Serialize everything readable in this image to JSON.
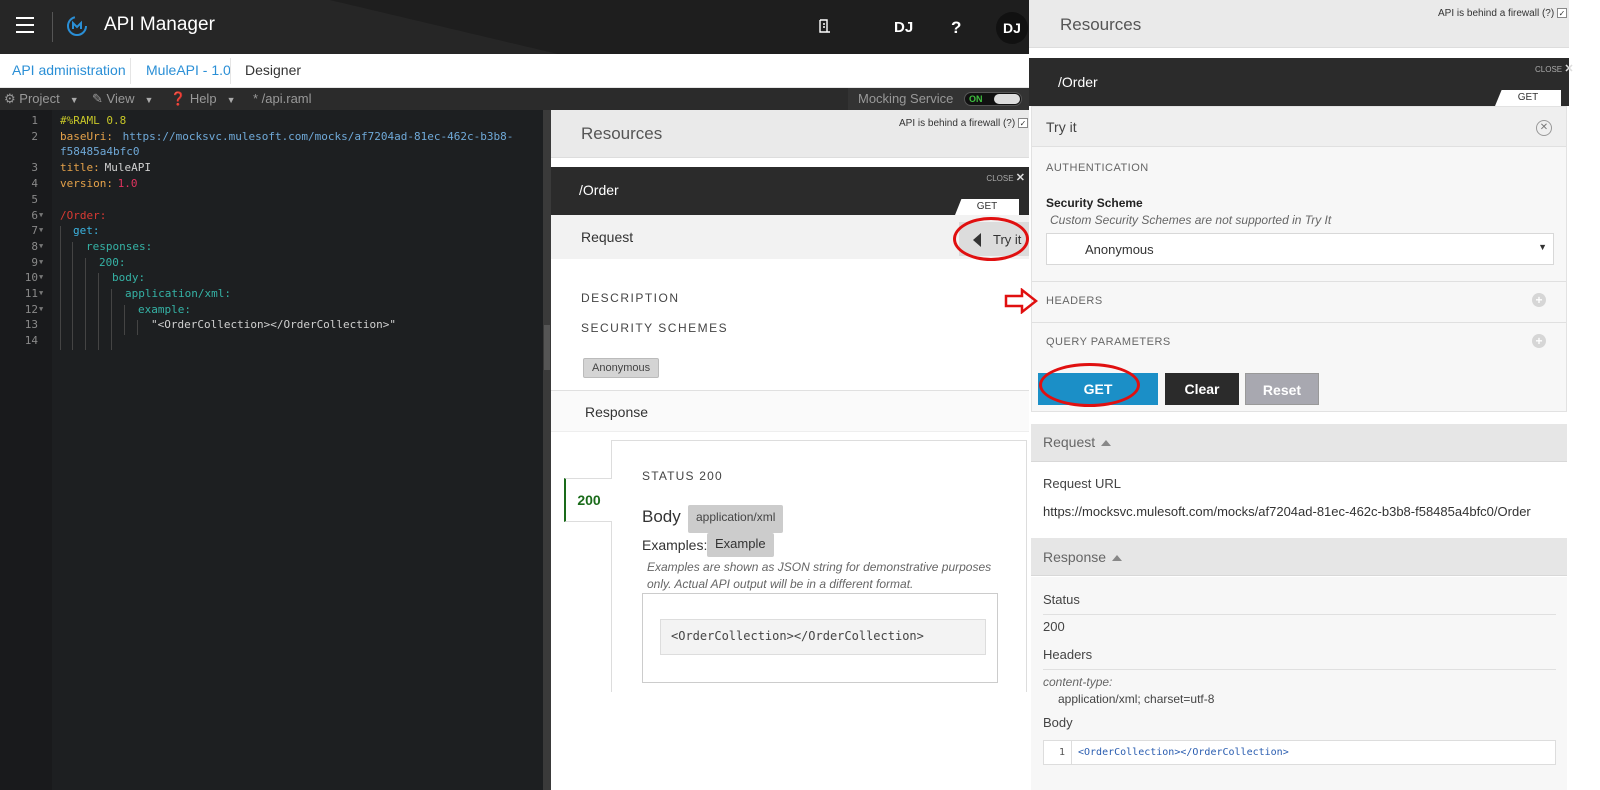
{
  "app": {
    "title": "API Manager",
    "user_initials": "DJ",
    "avatar_initials": "DJ",
    "help_symbol": "?"
  },
  "breadcrumb": [
    "API administration",
    "MuleAPI - 1.0",
    "Designer"
  ],
  "toolbar": {
    "project": "Project",
    "view": "View",
    "help": "Help",
    "file": "* /api.raml",
    "mocking_label": "Mocking Service",
    "mocking_state": "ON"
  },
  "editor": {
    "line_numbers": [
      "1",
      "2",
      "",
      "3",
      "4",
      "5",
      "6",
      "7",
      "8",
      "9",
      "10",
      "11",
      "12",
      "13",
      "14"
    ],
    "lines": {
      "l1": "#%RAML 0.8",
      "l2a_key": "baseUri:",
      "l2a_val": " https://mocksvc.mulesoft.com/mocks/af7204ad-81ec-462c-b3b8-",
      "l2b_val": "f58485a4bfc0",
      "l3_key": "title:",
      "l3_val": " MuleAPI",
      "l4_key": "version:",
      "l4_val": " 1.0",
      "l6": "/Order:",
      "l7": "get:",
      "l8": "responses:",
      "l9": "200:",
      "l10": "body:",
      "l11": "application/xml:",
      "l12": "example:",
      "l13": "\"<OrderCollection></OrderCollection>\""
    }
  },
  "docs": {
    "resources_title": "Resources",
    "firewall_label": "API is behind a firewall",
    "firewall_q": "(?)",
    "resource": "/Order",
    "close": "CLOSE",
    "method": "GET",
    "request_label": "Request",
    "tryit_label": "Try it",
    "description": "DESCRIPTION",
    "security_schemes": "SECURITY SCHEMES",
    "anonymous_badge": "Anonymous",
    "response_label": "Response",
    "status_code": "200",
    "status_title": "STATUS 200",
    "body_label": "Body",
    "body_type": "application/xml",
    "examples_label": "Examples:",
    "example_badge": "Example",
    "examples_note": "Examples are shown as JSON string for demonstrative purposes only. Actual API output will be in a different format.",
    "example_code": "<OrderCollection></OrderCollection>"
  },
  "tryit": {
    "title": "Try it",
    "authentication": "AUTHENTICATION",
    "security_scheme_label": "Security Scheme",
    "security_scheme_note": "Custom Security Schemes are not supported in Try It",
    "scheme_value": "Anonymous",
    "headers": "HEADERS",
    "query_parameters": "QUERY PARAMETERS",
    "get_button": "GET",
    "clear_button": "Clear",
    "reset_button": "Reset"
  },
  "result": {
    "request_label": "Request",
    "request_url_label": "Request URL",
    "request_url": "https://mocksvc.mulesoft.com/mocks/af7204ad-81ec-462c-b3b8-f58485a4bfc0/Order",
    "response_label": "Response",
    "status_label": "Status",
    "status_value": "200",
    "headers_label": "Headers",
    "content_type_key": "content-type:",
    "content_type_value": "application/xml; charset=utf-8",
    "body_label": "Body",
    "body_line_number": "1",
    "body_code": "<OrderCollection></OrderCollection>"
  },
  "colors": {
    "accent_blue": "#1b8fc7",
    "link_blue": "#2a8fd6",
    "status_green": "#1a6b1a",
    "annotation_red": "#e01010"
  },
  "icons": [
    "hamburger-icon",
    "mulesoft-logo-icon",
    "notifications-icon",
    "gear-icon",
    "edit-icon",
    "help-circle-icon",
    "close-icon",
    "triangle-left-icon",
    "plus-circle-icon",
    "caret-down-icon",
    "arrow-right-annotation-icon"
  ]
}
